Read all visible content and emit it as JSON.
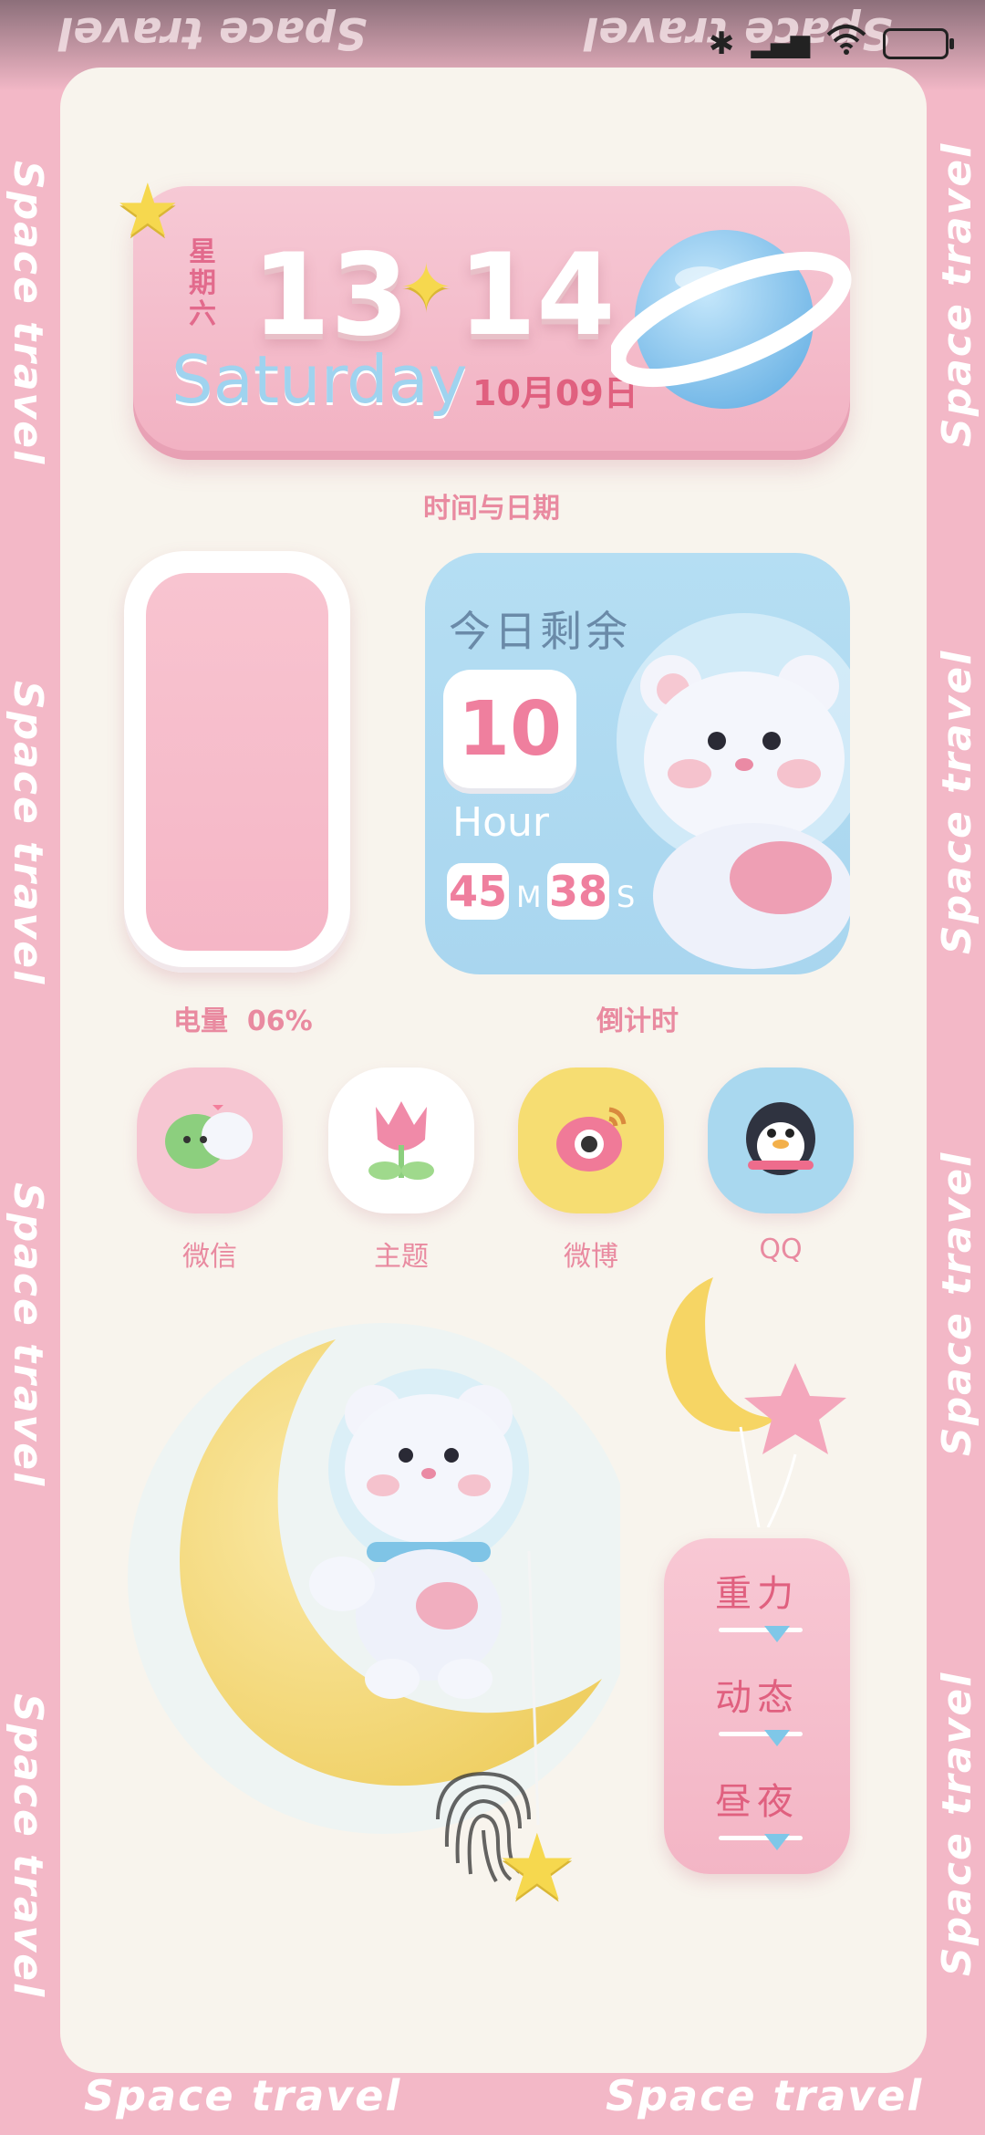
{
  "edge_text": "Space travel",
  "clock": {
    "weekday_cn": "星期六",
    "hour": "13",
    "minute": "14",
    "day_en": "Saturday",
    "date_cn": "10月09日",
    "caption": "时间与日期"
  },
  "battery_widget": {
    "label": "电量",
    "percent": "06%",
    "level": 0.06
  },
  "countdown": {
    "title": "今日剩余",
    "hours": "10",
    "hour_unit": "Hour",
    "minutes": "45",
    "minute_unit": "M",
    "seconds": "38",
    "second_unit": "S",
    "caption": "倒计时"
  },
  "apps": [
    {
      "label": "微信",
      "icon": "wechat-icon",
      "bg": "#f6c6d2"
    },
    {
      "label": "主题",
      "icon": "tulip-icon",
      "bg": "#ffffff"
    },
    {
      "label": "微博",
      "icon": "weibo-icon",
      "bg": "#f6dd72"
    },
    {
      "label": "QQ",
      "icon": "penguin-icon",
      "bg": "#a9d8ef"
    }
  ],
  "sliders": [
    {
      "label": "重力"
    },
    {
      "label": "动态"
    },
    {
      "label": "昼夜"
    }
  ],
  "colors": {
    "frame_pink": "#f3b8c7",
    "panel_cream": "#f8f4ed",
    "accent_pink": "#e0607f",
    "sky_blue": "#a9d6ef",
    "moon_yellow": "#f6d97a"
  }
}
